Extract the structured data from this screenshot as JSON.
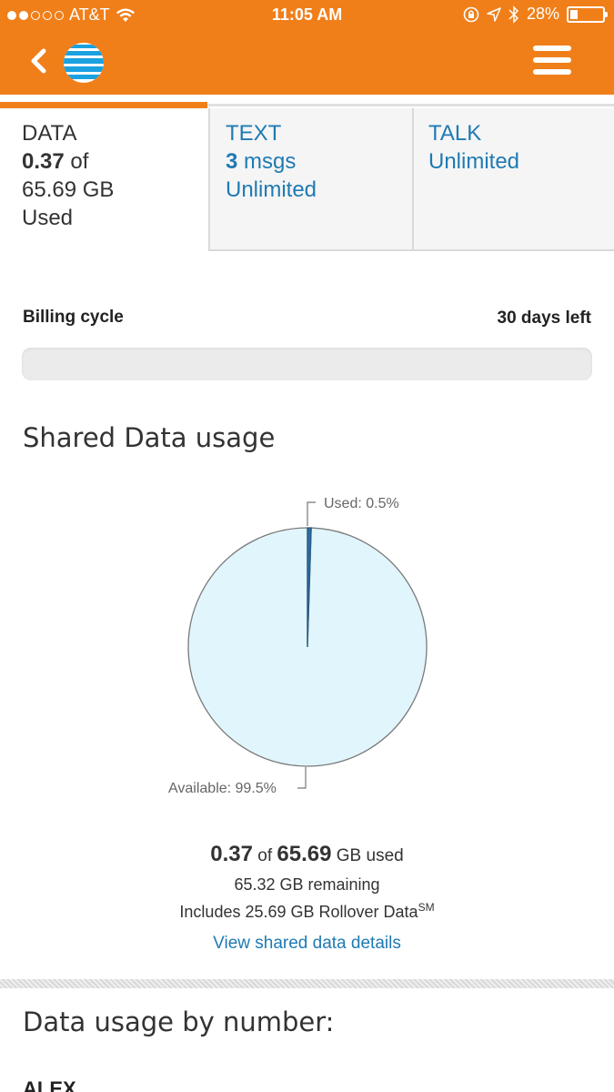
{
  "status_bar": {
    "carrier": "AT&T",
    "time": "11:05 AM",
    "battery": "28%",
    "battery_level": 0.28,
    "signal_bars_filled": 2,
    "signal_bars_total": 5
  },
  "header": {
    "back_icon": "chevron-left-icon",
    "logo_icon": "att-globe-icon",
    "menu_icon": "hamburger-menu-icon"
  },
  "tabs": {
    "data": {
      "title": "DATA",
      "amount": "0.37",
      "of": "of",
      "total": "65.69 GB",
      "used": "Used"
    },
    "text": {
      "title": "TEXT",
      "count": "3",
      "unit": "msgs",
      "plan": "Unlimited"
    },
    "talk": {
      "title": "TALK",
      "plan": "Unlimited"
    }
  },
  "billing": {
    "label": "Billing cycle",
    "days_left": "30 days left",
    "progress": 0
  },
  "shared": {
    "title": "Shared Data usage",
    "used_label": "Used: 0.5%",
    "available_label": "Available: 99.5%",
    "used_amount": "0.37",
    "of": "of",
    "total_amount": "65.69",
    "used_suffix": "GB used",
    "remaining": "65.32 GB remaining",
    "rollover": "Includes 25.69 GB Rollover Data",
    "rollover_mark": "SM",
    "details_link": "View shared data details"
  },
  "chart_data": {
    "type": "pie",
    "slices": [
      {
        "label": "Used",
        "value": 0.5,
        "color": "#2a6ea6"
      },
      {
        "label": "Available",
        "value": 99.5,
        "color": "#e1f5fc"
      }
    ]
  },
  "by_number": {
    "title": "Data usage by number:",
    "first_name": "ALEX"
  },
  "colors": {
    "brand": "#f07f1a",
    "link": "#1f7ab3"
  }
}
